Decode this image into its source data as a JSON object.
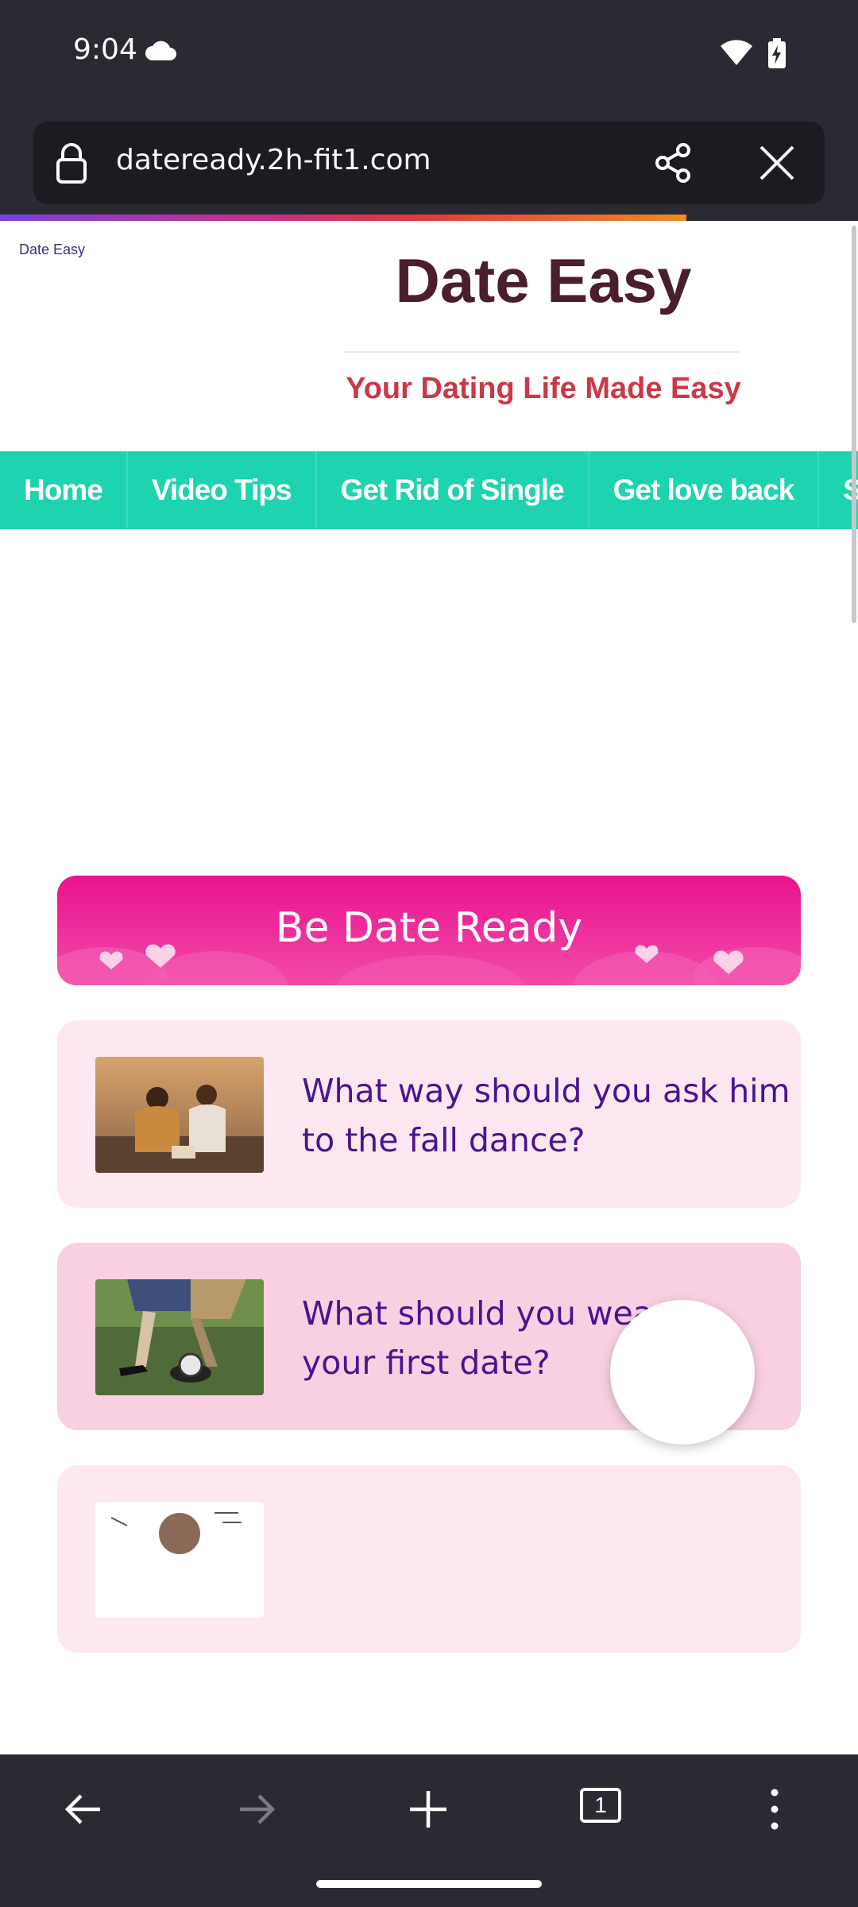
{
  "status": {
    "time": "9:04"
  },
  "browser": {
    "url": "dateready.2h-fit1.com",
    "tabs_count": "1"
  },
  "site": {
    "tag": "Date Easy",
    "title": "Date Easy",
    "tagline": "Your Dating Life Made Easy"
  },
  "nav": {
    "items": [
      "Home",
      "Video Tips",
      "Get Rid of Single",
      "Get love back",
      "Spar"
    ]
  },
  "banner": {
    "title": "Be Date Ready"
  },
  "articles": [
    {
      "title": "What way should you ask him to the fall dance?"
    },
    {
      "title": "What should you wear on your first date?"
    },
    {
      "title": ""
    }
  ],
  "colors": {
    "nav_bg": "#1dd3b0",
    "title": "#4a1e2a",
    "tagline": "#cc3848",
    "banner": "#e9138f",
    "article_text": "#4b1291",
    "chrome": "#2b2a33"
  }
}
